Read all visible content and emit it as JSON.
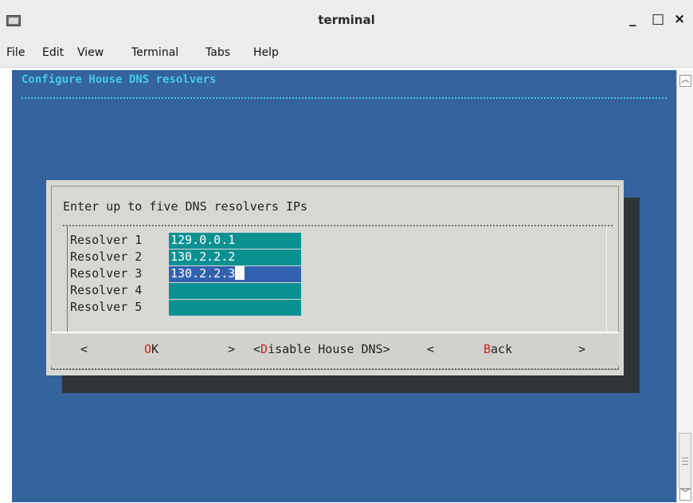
{
  "window": {
    "title": "terminal",
    "minimize_label": "_",
    "maximize_label": "□",
    "close_label": "×"
  },
  "menu": {
    "items": [
      "File",
      "Edit",
      "View",
      "Terminal",
      "Tabs",
      "Help"
    ]
  },
  "screen": {
    "title": "Configure House DNS resolvers"
  },
  "dialog": {
    "prompt": "Enter up to five DNS resolvers IPs",
    "resolvers": [
      {
        "label": "Resolver 1",
        "value": "129.0.0.1"
      },
      {
        "label": "Resolver 2",
        "value": "130.2.2.2"
      },
      {
        "label": "Resolver 3",
        "value": "130.2.2.3"
      },
      {
        "label": "Resolver 4",
        "value": ""
      },
      {
        "label": "Resolver 5",
        "value": ""
      }
    ],
    "buttons": {
      "ok": {
        "left": "<",
        "hot": "O",
        "rest": "K",
        "right": ">"
      },
      "disable": {
        "left": "<",
        "hot": "D",
        "rest": "isable House DNS",
        "right": ">"
      },
      "back": {
        "left": "<",
        "hot": "B",
        "rest": "ack",
        "right": ">"
      }
    }
  },
  "colors": {
    "terminal_bg": "#34639e",
    "title_text": "#45c8e8",
    "field_bg": "#0c9192",
    "active_field_bg": "#3261b0",
    "hotkey": "#d02020"
  },
  "icons": {
    "app": "terminal-app-icon",
    "scroll_up": "scroll-up-arrow-icon",
    "scroll_down": "scroll-down-arrow-icon"
  }
}
